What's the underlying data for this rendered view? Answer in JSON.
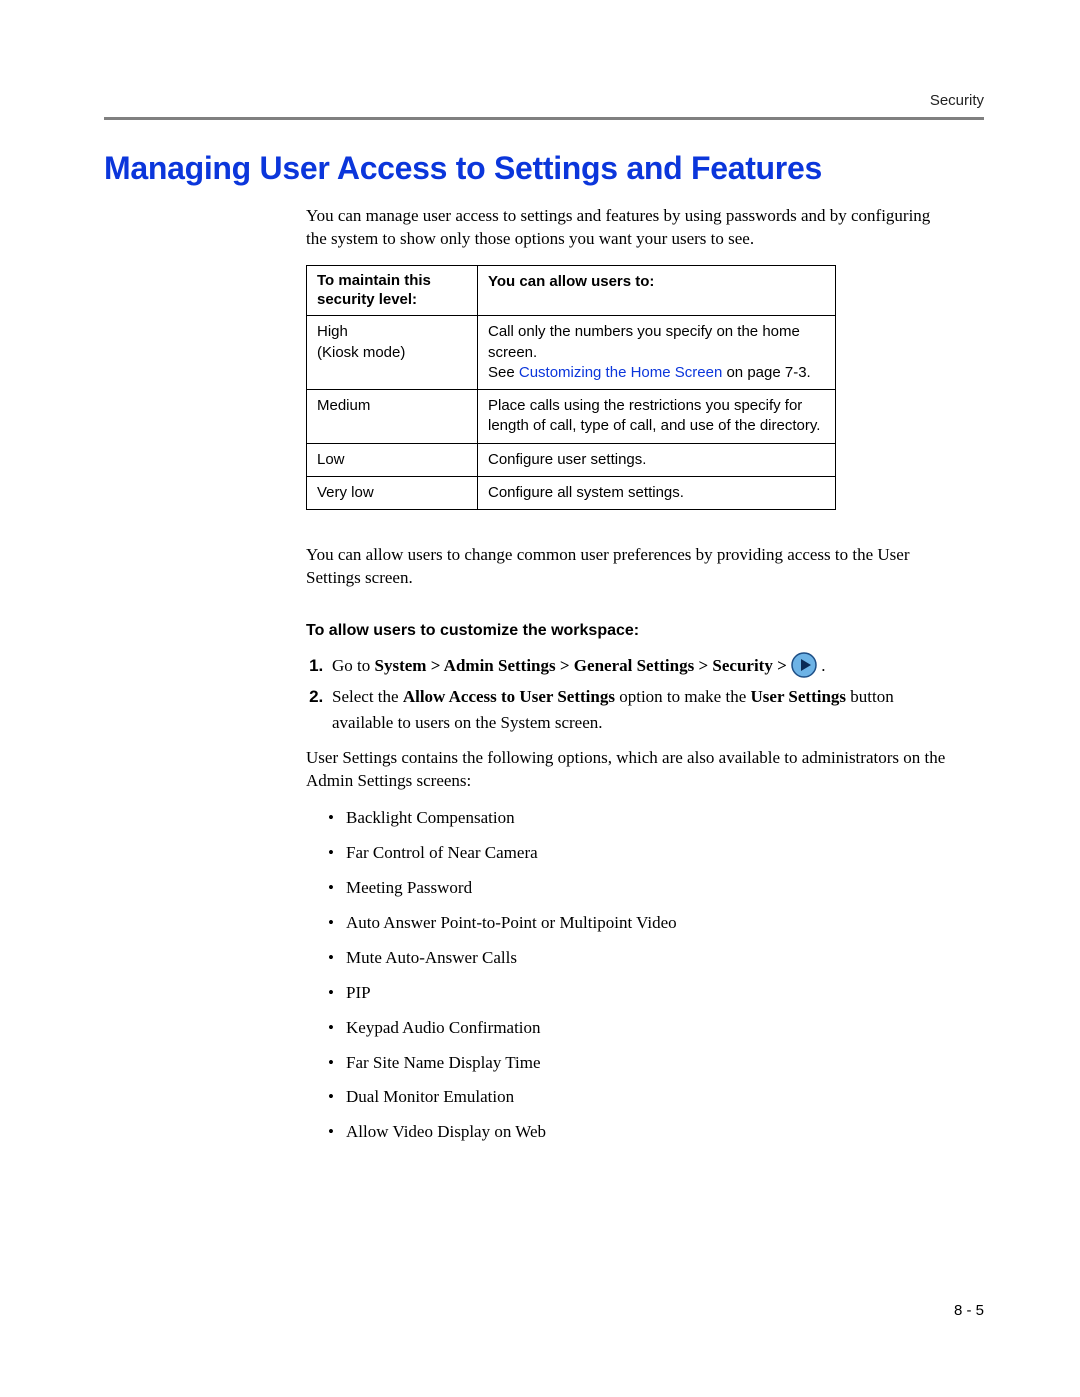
{
  "header": {
    "label": "Security"
  },
  "title": "Managing User Access to Settings and Features",
  "intro": "You can manage user access to settings and features by using passwords and by configuring the system to show only those options you want your users to see.",
  "table": {
    "col1_header_l1": "To maintain this",
    "col1_header_l2": "security level:",
    "col2_header": "You can allow users to:",
    "rows": [
      {
        "level_l1": "High",
        "level_l2": "(Kiosk mode)",
        "desc_pre": "Call only the numbers you specify on the home screen.",
        "desc_see": "See ",
        "desc_link": "Customizing the Home Screen",
        "desc_post": " on page 7-3."
      },
      {
        "level_l1": "Medium",
        "desc_pre": "Place calls using the restrictions you specify for length of call, type of call, and use of the directory."
      },
      {
        "level_l1": "Low",
        "desc_pre": "Configure user settings."
      },
      {
        "level_l1": "Very low",
        "desc_pre": "Configure all system settings."
      }
    ]
  },
  "after_table": "You can allow users to change common user preferences by providing access to the User Settings screen.",
  "subhead": "To allow users to customize the workspace:",
  "steps": {
    "s1_pre": "Go to ",
    "s1_bold": "System > Admin Settings > General Settings > Security > ",
    "s1_post": " .",
    "s2_pre": "Select the ",
    "s2_b1": "Allow Access to User Settings",
    "s2_mid": " option to make the ",
    "s2_b2": "User Settings",
    "s2_post": " button available to users on the System screen."
  },
  "after_steps": "User Settings contains the following options, which are also available to administrators on the Admin Settings screens:",
  "bullets": [
    "Backlight Compensation",
    "Far Control of Near Camera",
    "Meeting Password",
    "Auto Answer Point-to-Point or Multipoint Video",
    "Mute Auto-Answer Calls",
    "PIP",
    "Keypad Audio Confirmation",
    "Far Site Name Display Time",
    "Dual Monitor Emulation",
    "Allow Video Display on Web"
  ],
  "page_num": "8 - 5"
}
